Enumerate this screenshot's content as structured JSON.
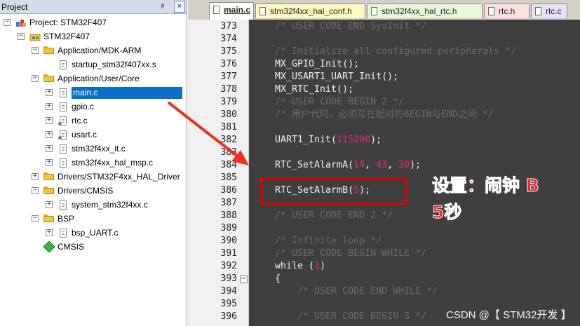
{
  "project_panel": {
    "title": "Project",
    "pin_glyph": "ᵖ",
    "close_glyph": "×",
    "tree": [
      {
        "label": "Project: STM32F407",
        "icon": "project-icon",
        "expand": "−"
      },
      {
        "label": "STM32F407",
        "icon": "target-icon",
        "expand": "−"
      },
      {
        "label": "Application/MDK-ARM",
        "icon": "folder-icon",
        "expand": "−"
      },
      {
        "label": "startup_stm32f407xx.s",
        "icon": "file-icon"
      },
      {
        "label": "Application/User/Core",
        "icon": "folder-icon",
        "expand": "−"
      },
      {
        "label": "main.c",
        "icon": "file-icon",
        "expand": "+",
        "selected": true
      },
      {
        "label": "gpio.c",
        "icon": "file-icon",
        "expand": "+"
      },
      {
        "label": "rtc.c",
        "icon": "file-key-icon",
        "expand": "+"
      },
      {
        "label": "usart.c",
        "icon": "file-key-icon",
        "expand": "+"
      },
      {
        "label": "stm32f4xx_it.c",
        "icon": "file-icon",
        "expand": "+"
      },
      {
        "label": "stm32f4xx_hal_msp.c",
        "icon": "file-icon",
        "expand": "+"
      },
      {
        "label": "Drivers/STM32F4xx_HAL_Driver",
        "icon": "folder-icon",
        "expand": "+"
      },
      {
        "label": "Drivers/CMSIS",
        "icon": "folder-icon",
        "expand": "−"
      },
      {
        "label": "system_stm32f4xx.c",
        "icon": "file-icon",
        "expand": "+"
      },
      {
        "label": "BSP",
        "icon": "folder-icon",
        "expand": "−"
      },
      {
        "label": "bsp_UART.c",
        "icon": "file-icon",
        "expand": "+"
      },
      {
        "label": "CMSIS",
        "icon": "cmsis-diamond-icon"
      }
    ]
  },
  "tabs": [
    {
      "label": "main.c",
      "active": true,
      "color": "#ffffff"
    },
    {
      "label": "stm32f4xx_hal_conf.h",
      "color": "#fff8c0"
    },
    {
      "label": "stm32f4xx_hal_rtc.h",
      "color": "#e9f7d9"
    },
    {
      "label": "rtc.h",
      "color": "#fde0e4"
    },
    {
      "label": "rtc.c",
      "color": "#e8e0f4"
    }
  ],
  "code_lines": [
    {
      "n": "373",
      "text": "/* USER CODE END SysInit */",
      "type": "comment"
    },
    {
      "n": "374",
      "text": "",
      "type": "plain"
    },
    {
      "n": "375",
      "text": "/* Initialize all configured peripherals */",
      "type": "comment"
    },
    {
      "n": "376",
      "text": "MX_GPIO_Init();",
      "type": "plain"
    },
    {
      "n": "377",
      "text": "MX_USART1_UART_Init();",
      "type": "plain"
    },
    {
      "n": "378",
      "text": "MX_RTC_Init();",
      "type": "plain"
    },
    {
      "n": "379",
      "text": "/* USER CODE BEGIN 2 */",
      "type": "comment"
    },
    {
      "n": "380",
      "text": "/* 用户代码，必须写在配对的BEGIN与END之间 */",
      "type": "comment"
    },
    {
      "n": "381",
      "text": "",
      "type": "plain"
    },
    {
      "n": "382",
      "pre": "UART1_Init(",
      "nums": [
        "115200"
      ],
      "post": ");",
      "type": "call"
    },
    {
      "n": "383",
      "text": "",
      "type": "plain"
    },
    {
      "n": "384",
      "pre": "RTC_SetAlarmA(",
      "nums": [
        "14",
        "43",
        "30"
      ],
      "post": ");",
      "type": "call"
    },
    {
      "n": "385",
      "text": "",
      "type": "plain"
    },
    {
      "n": "386",
      "pre": "RTC_SetAlarmB(",
      "nums": [
        "5"
      ],
      "post": ");",
      "type": "call"
    },
    {
      "n": "387",
      "text": "",
      "type": "plain"
    },
    {
      "n": "388",
      "text": "/* USER CODE END 2 */",
      "type": "comment"
    },
    {
      "n": "389",
      "text": "",
      "type": "plain"
    },
    {
      "n": "390",
      "text": "/* Infinite loop */",
      "type": "comment"
    },
    {
      "n": "391",
      "text": "/* USER CODE BEGIN WHILE */",
      "type": "comment"
    },
    {
      "n": "392",
      "pre": "while (",
      "nums": [
        "1"
      ],
      "post": ")",
      "type": "call"
    },
    {
      "n": "393",
      "text": "{",
      "type": "plain"
    },
    {
      "n": "394",
      "text": "    /* USER CODE END WHILE */",
      "type": "comment"
    },
    {
      "n": "395",
      "text": "",
      "type": "plain"
    },
    {
      "n": "396",
      "text": "    /* USER CODE BEGIN 3 */",
      "type": "comment"
    }
  ],
  "annotation": {
    "line1": "设置：闹钟 B",
    "line2": "5秒"
  },
  "watermark": "CSDN @【 STM32开发 】",
  "colors": {
    "accent": "#e50000",
    "selection": "#0a6fc9",
    "editor_bg": "#3f3f3f",
    "number": "#e5267f"
  }
}
